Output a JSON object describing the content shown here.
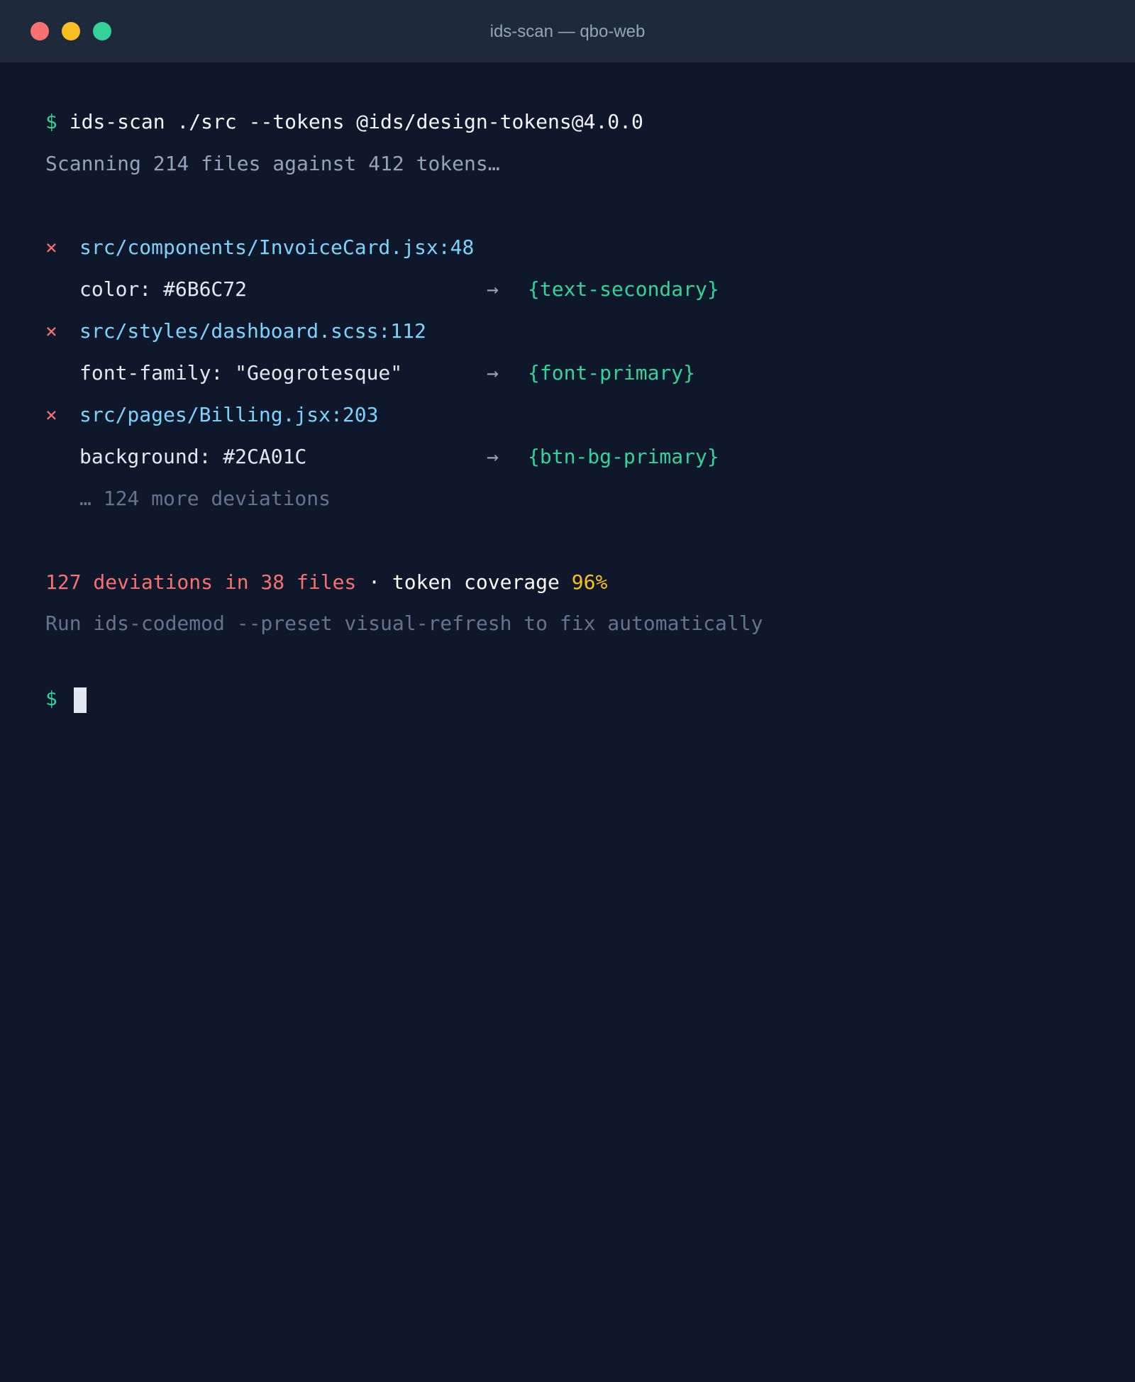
{
  "window": {
    "title": "ids-scan — qbo-web",
    "traffic_lights": {
      "close_color": "#f87171",
      "minimize_color": "#fbbf24",
      "zoom_color": "#34d399"
    }
  },
  "terminal": {
    "prompt_symbol": "$",
    "command": "ids-scan ./src --tokens @ids/design-tokens@4.0.0",
    "scanning": "Scanning 214 files against 412 tokens…",
    "error_mark": "×",
    "arrow": "→",
    "deviations": [
      {
        "location": "src/components/InvoiceCard.jsx:48",
        "property": "color: #6B6C72",
        "token": "{text-secondary}"
      },
      {
        "location": "src/styles/dashboard.scss:112",
        "property": "font-family: \"Geogrotesque\"",
        "token": "{font-primary}"
      },
      {
        "location": "src/pages/Billing.jsx:203",
        "property": "background: #2CA01C",
        "token": "{btn-bg-primary}"
      }
    ],
    "more": "… 124 more deviations",
    "summary": {
      "deviations": "127 deviations in 38 files",
      "separator": "·",
      "coverage_label": "token coverage",
      "coverage_value": "96%"
    },
    "hint": "Run ids-codemod --preset visual-refresh to fix automatically"
  }
}
